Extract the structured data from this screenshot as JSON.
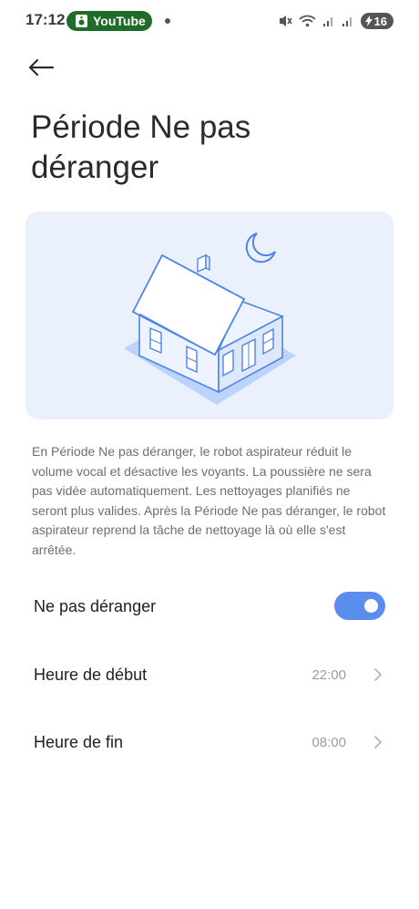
{
  "status_bar": {
    "time": "17:12",
    "app_pill": "YouTube",
    "battery": "16",
    "icons": [
      "speaker-icon",
      "mute-icon",
      "wifi-icon",
      "signal-icon",
      "signal-icon",
      "battery-icon"
    ]
  },
  "header": {
    "back_icon": "arrow-left-icon",
    "title": "Période Ne pas déranger"
  },
  "illustration": {
    "subject": "house-icon",
    "moon": "moon-icon",
    "colors": {
      "background": "#eaf1fd",
      "line": "#4f84e6",
      "shadow": "#bcd3fb"
    }
  },
  "description": "En Période Ne pas déranger, le robot aspirateur réduit le volume vocal et désactive les voyants. La poussière ne sera pas vidée automatiquement. Les nettoyages planifiés ne seront plus valides. Après la Période Ne pas déranger, le robot aspirateur reprend la tâche de nettoyage là où elle s'est arrêtée.",
  "settings": {
    "dnd": {
      "label": "Ne pas déranger",
      "enabled": true,
      "accent": "#5b8def"
    },
    "start": {
      "label": "Heure de début",
      "value": "22:00"
    },
    "end": {
      "label": "Heure de fin",
      "value": "08:00"
    }
  }
}
